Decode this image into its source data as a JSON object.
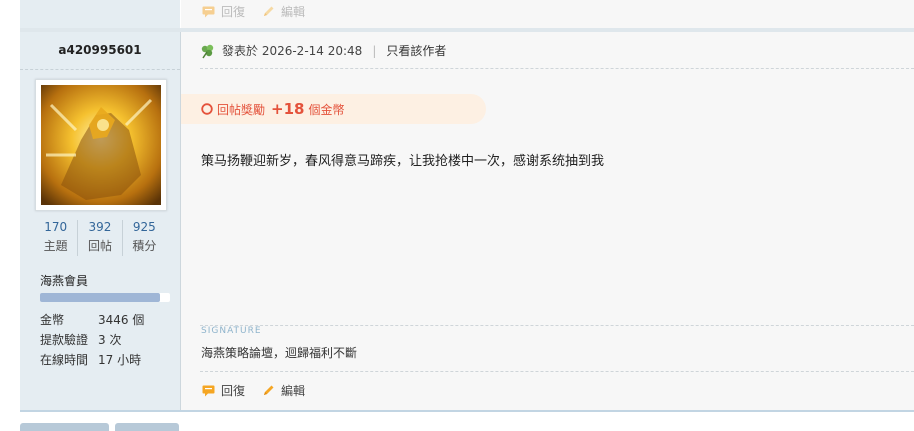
{
  "prev_post": {
    "reply_label": "回復",
    "edit_label": "編輯"
  },
  "post": {
    "username": "a420995601",
    "stats": [
      {
        "value": "170",
        "label": "主題"
      },
      {
        "value": "392",
        "label": "回帖"
      },
      {
        "value": "925",
        "label": "積分"
      }
    ],
    "rank": "海燕會員",
    "rank_progress": 0.92,
    "info": [
      {
        "key": "金幣",
        "value": "3446 個"
      },
      {
        "key": "提款驗證",
        "value": "3 次"
      },
      {
        "key": "在線時間",
        "value": "17 小時"
      }
    ],
    "posted_label": "發表於 2026-2-14 20:48",
    "separator": "|",
    "author_only": "只看該作者",
    "reward": {
      "prefix": "回帖獎勵",
      "amount": "+18",
      "unit": "個金幣"
    },
    "content": "策马扬鞭迎新岁，春风得意马蹄疾，让我抢楼中一次，感谢系统抽到我",
    "signature_heading": "SIGNATURE",
    "signature": "海燕策略論壇，迴歸福利不斷",
    "reply_label": "回復",
    "edit_label": "編輯"
  },
  "colors": {
    "accent_orange": "#f5a623",
    "reward_red": "#e4523b",
    "sidebar_bg": "#e5edf2",
    "link_blue": "#336699"
  }
}
